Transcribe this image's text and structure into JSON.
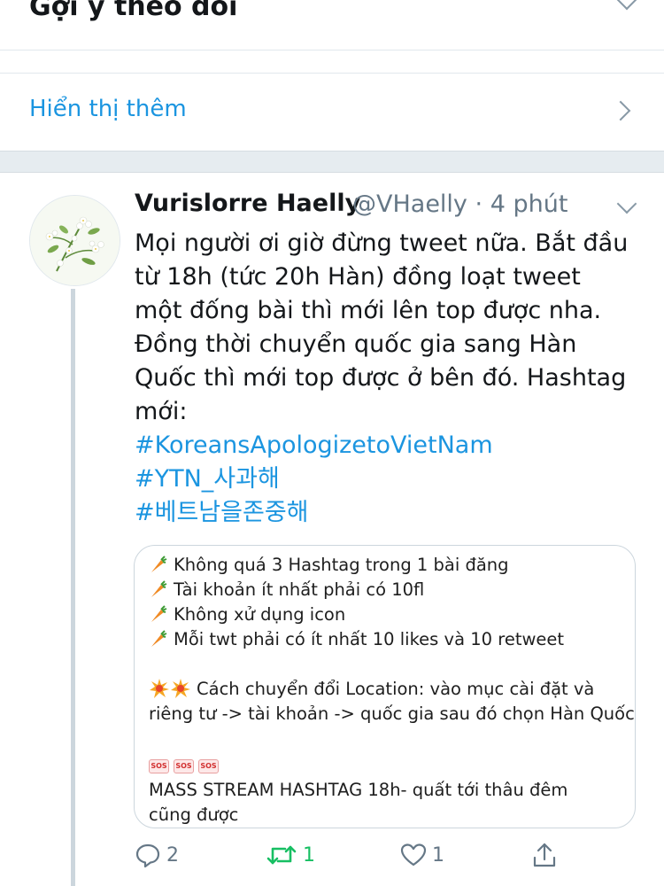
{
  "section": {
    "title": "Gợi ý theo dõi",
    "show_more": "Hiển thị thêm"
  },
  "tweet": {
    "author_name": "Vurislorre Haelly",
    "handle": "@VHaelly",
    "separator": "·",
    "time": "4 phút",
    "text_lines": [
      "Mọi người ơi giờ đừng tweet nữa. Bắt đầu",
      "từ 18h (tức 20h Hàn) đồng loạt tweet",
      "một đống bài thì mới lên top được nha.",
      "Đồng thời chuyển quốc gia sang Hàn",
      "Quốc thì mới top được ở bên đó. Hashtag",
      "mới:"
    ],
    "hashtags": [
      "#KoreansApologizetoVietNam",
      "#YTN_사과해",
      "#베트남을존중해"
    ],
    "image_card": {
      "rules": [
        "Không quá 3 Hashtag trong 1 bài đăng",
        "Tài khoản ít nhất phải có 10fl",
        "Không xử dụng icon",
        "Mỗi twt phải có ít nhất 10 likes và 10 retweet"
      ],
      "location_line_1": "Cách chuyển đổi Location: vào mục cài đặt và",
      "location_line_2": "riêng tư -> tài khoản -> quốc gia sau đó chọn Hàn Quốc",
      "sos_label": "SOS",
      "stream_line_1": "MASS STREAM HASHTAG 18h- quất tới thâu đêm",
      "stream_line_2": "cũng được"
    },
    "actions": {
      "reply_count": "2",
      "retweet_count": "1",
      "like_count": "1"
    }
  },
  "colors": {
    "link": "#1b95e0",
    "retweet_active": "#17bf63",
    "muted": "#657786",
    "divider": "#e1e8ed"
  },
  "icons": [
    "chevron-down-icon",
    "chevron-right-icon",
    "reply-icon",
    "retweet-icon",
    "like-icon",
    "share-icon",
    "carrot-icon",
    "collision-icon",
    "sos-icon"
  ]
}
